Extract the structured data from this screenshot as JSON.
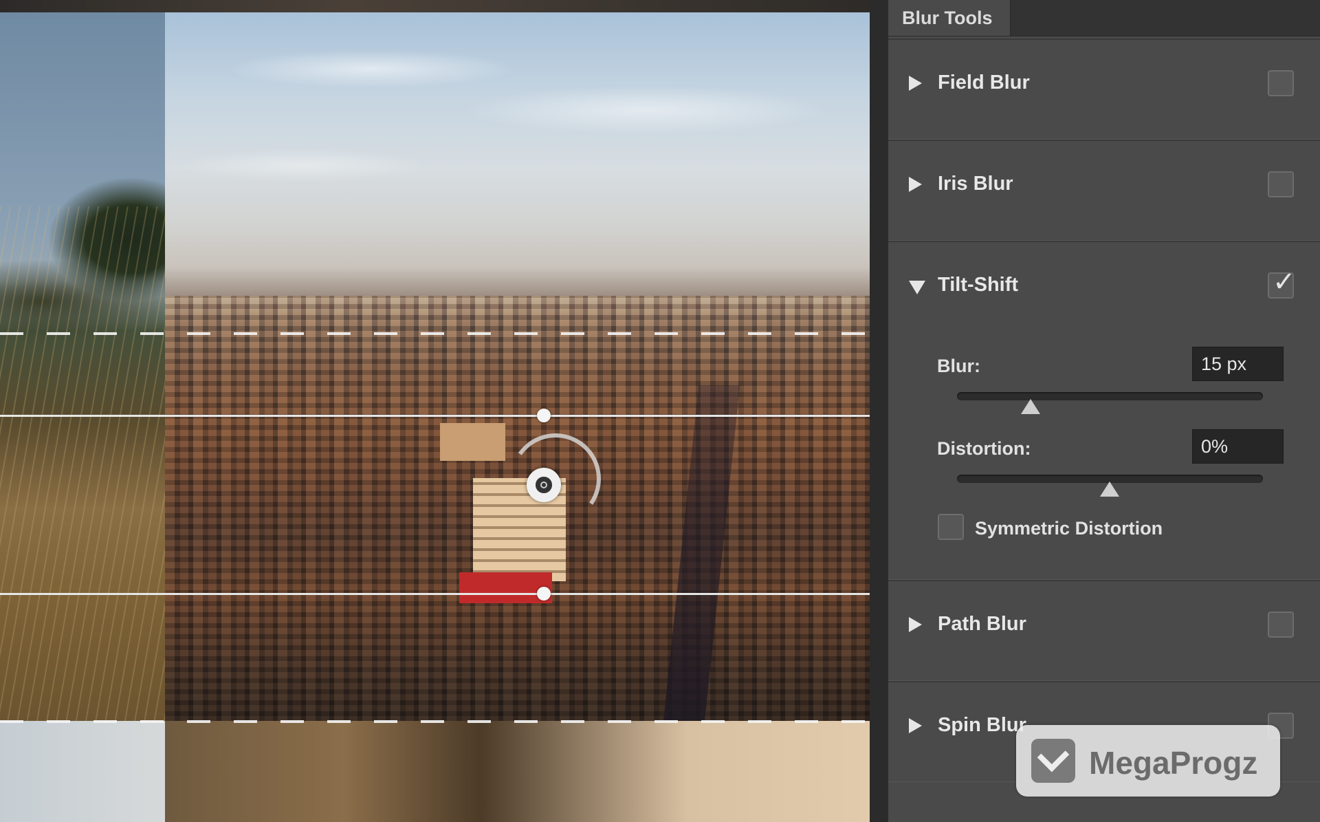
{
  "canvas": {
    "description_icons": [
      "blur-pin-icon",
      "rotation-arc-icon"
    ]
  },
  "panel": {
    "tab_label": "Blur Tools",
    "sections": [
      {
        "label": "Field Blur",
        "expanded": false,
        "checked": false
      },
      {
        "label": "Iris Blur",
        "expanded": false,
        "checked": false
      },
      {
        "label": "Tilt-Shift",
        "expanded": true,
        "checked": true
      },
      {
        "label": "Path Blur",
        "expanded": false,
        "checked": false
      },
      {
        "label": "Spin Blur",
        "expanded": false,
        "checked": false
      }
    ],
    "tilt_shift": {
      "blur_label": "Blur:",
      "blur_value": "15 px",
      "blur_slider_fraction": 0.24,
      "distortion_label": "Distortion:",
      "distortion_value": "0%",
      "distortion_slider_fraction": 0.5,
      "symmetric_label": "Symmetric Distortion",
      "symmetric_checked": false
    }
  },
  "watermark": {
    "text": "MegaProgz"
  },
  "colors": {
    "panel_bg": "#4a4a4a",
    "panel_header": "#333333",
    "field_bg": "#262626"
  }
}
